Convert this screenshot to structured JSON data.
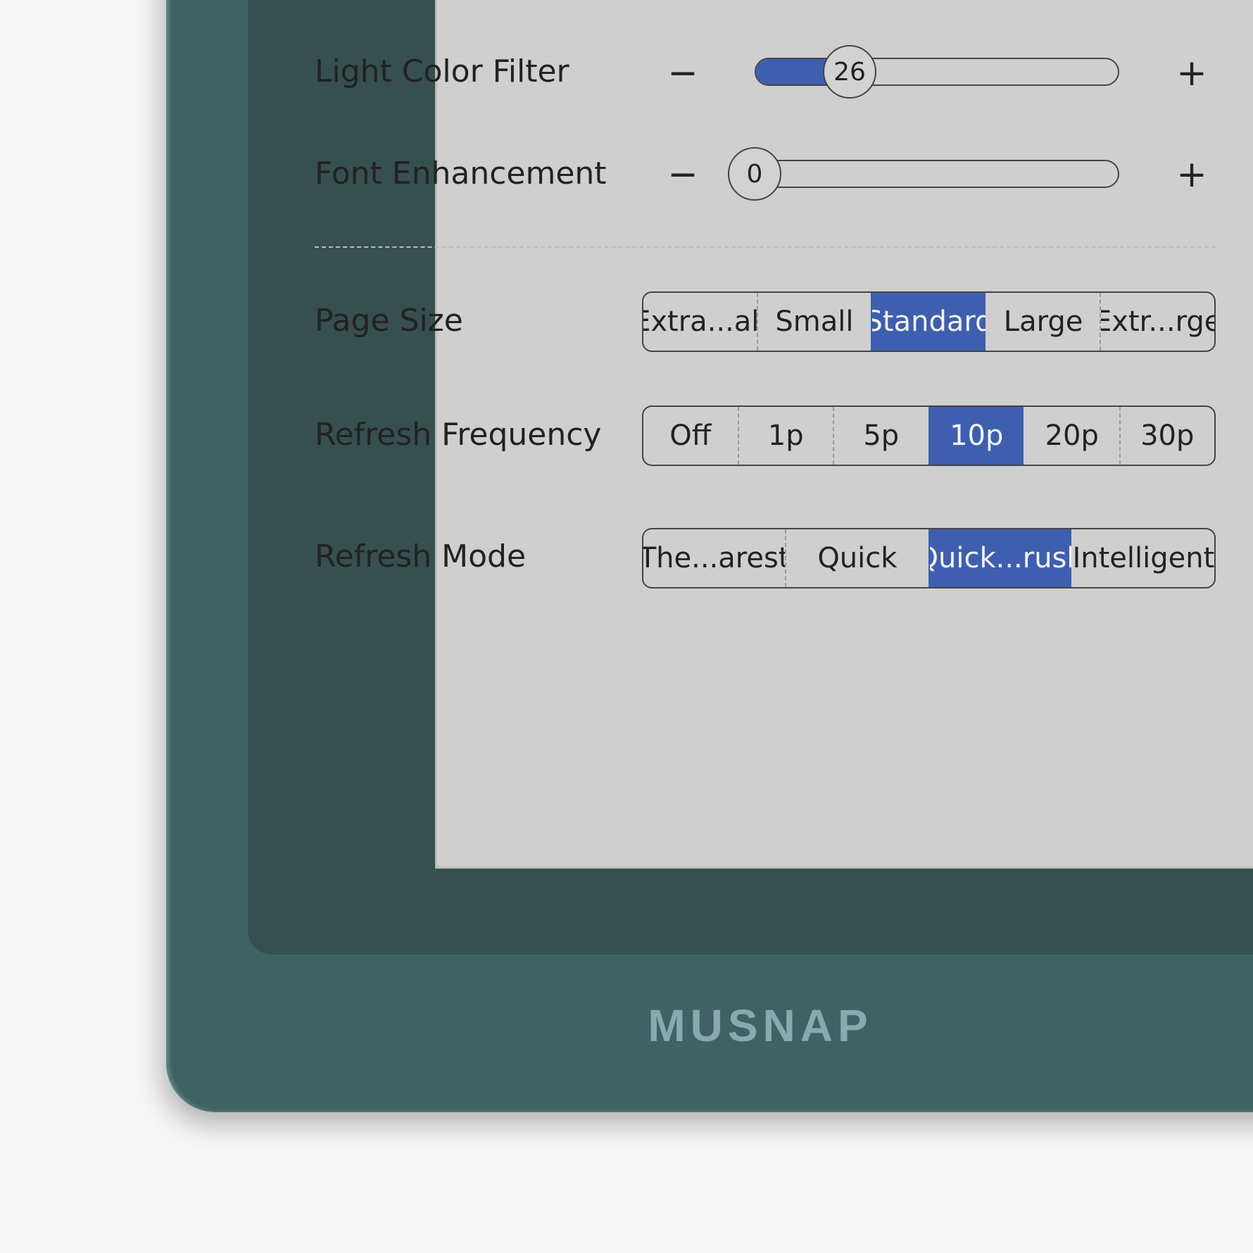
{
  "brand": "MUSNAP",
  "colors": {
    "accent": "#3e5fb0",
    "bezel": "#3f6362",
    "screen": "#cfcfcf"
  },
  "light_color_filter": {
    "label": "Light Color Filter",
    "minus": "−",
    "plus": "+",
    "value": "26",
    "fill_percent": 22
  },
  "font_enhancement": {
    "label": "Font Enhancement",
    "minus": "−",
    "plus": "+",
    "value": "0",
    "fill_percent": 0
  },
  "page_size": {
    "label": "Page Size",
    "options": [
      "Extra...all",
      "Small",
      "Standard",
      "Large",
      "Extr...rge"
    ],
    "selected": "Standard"
  },
  "refresh_frequency": {
    "label": "Refresh Frequency",
    "options": [
      "Off",
      "1p",
      "5p",
      "10p",
      "20p",
      "30p"
    ],
    "selected": "10p"
  },
  "refresh_mode": {
    "label": "Refresh Mode",
    "options": [
      "The...arest",
      "Quick",
      "Quick...rush",
      "Intelligent"
    ],
    "selected": "Quick...rush"
  }
}
